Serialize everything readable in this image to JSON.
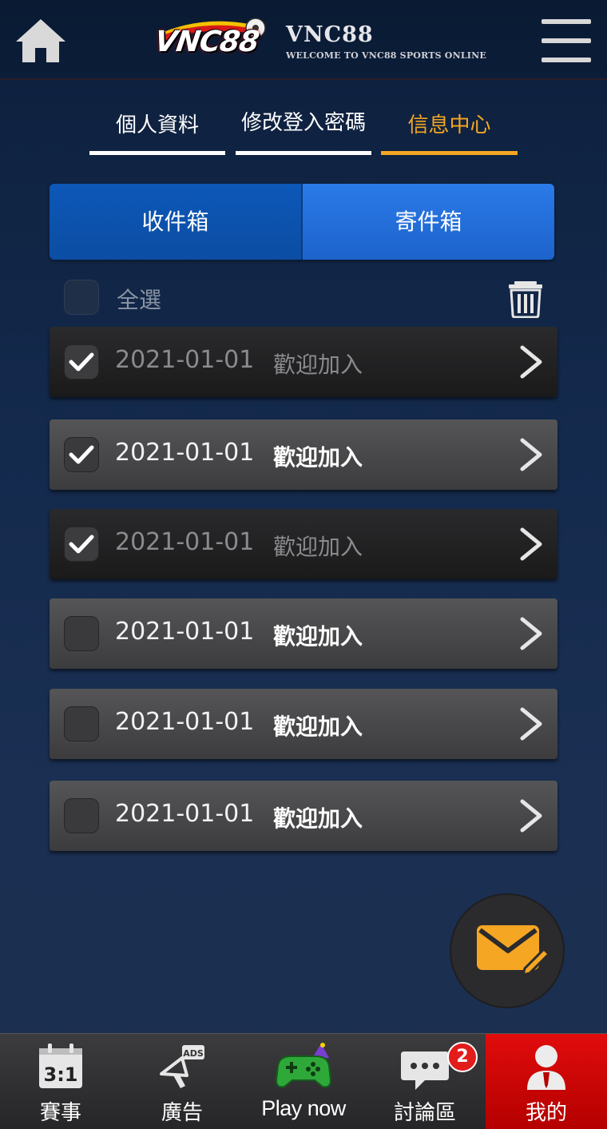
{
  "header": {
    "logo_text": "VNC88",
    "brand_title": "VNC88",
    "brand_subtitle": "WELCOME TO VNC88 SPORTS ONLINE",
    "home_icon": "home-icon",
    "menu_icon": "hamburger-menu-icon"
  },
  "top_tabs": [
    {
      "label": "個人資料",
      "active": false
    },
    {
      "label": "修改登入密碼",
      "active": false
    },
    {
      "label": "信息中心",
      "active": true
    }
  ],
  "box_tabs": {
    "inbox": "收件箱",
    "outbox": "寄件箱"
  },
  "select_all": {
    "label": "全選",
    "checked": false
  },
  "messages": [
    {
      "date": "2021-01-01",
      "title": "歡迎加入",
      "read": true,
      "checked": true
    },
    {
      "date": "2021-01-01",
      "title": "歡迎加入",
      "read": false,
      "checked": true
    },
    {
      "date": "2021-01-01",
      "title": "歡迎加入",
      "read": true,
      "checked": true
    },
    {
      "date": "2021-01-01",
      "title": "歡迎加入",
      "read": false,
      "checked": false
    },
    {
      "date": "2021-01-01",
      "title": "歡迎加入",
      "read": false,
      "checked": false
    },
    {
      "date": "2021-01-01",
      "title": "歡迎加入",
      "read": false,
      "checked": false
    }
  ],
  "bottom_nav": {
    "matches": {
      "label": "賽事",
      "icon_text": "3:1"
    },
    "ads": {
      "label": "廣告",
      "icon_text": "ADS"
    },
    "play": {
      "label": "Play now"
    },
    "forum": {
      "label": "討論區",
      "badge": "2"
    },
    "me": {
      "label": "我的",
      "active": true
    }
  },
  "colors": {
    "accent": "#f5a623",
    "active_nav": "#d40606",
    "tab_blue": "#1d63cc"
  }
}
